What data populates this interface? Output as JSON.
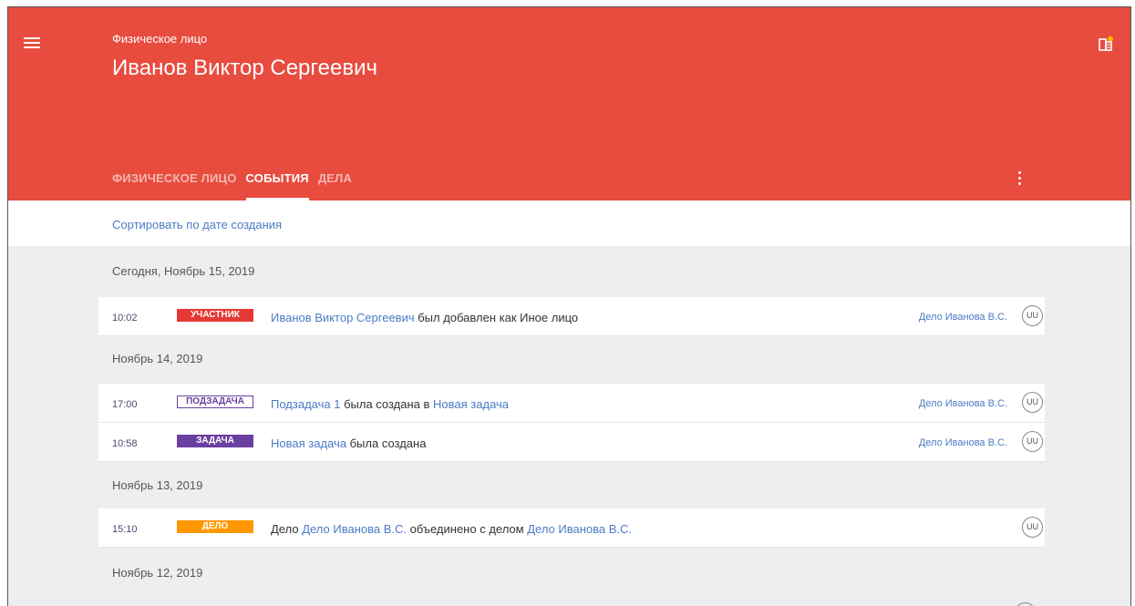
{
  "header": {
    "subtitle": "Физическое лицо",
    "title": "Иванов Виктор Сергеевич",
    "tabs": [
      {
        "label": "ФИЗИЧЕСКОЕ ЛИЦО",
        "active": false
      },
      {
        "label": "СОБЫТИЯ",
        "active": true
      },
      {
        "label": "ДЕЛА",
        "active": false
      }
    ],
    "icons": {
      "menu": "menu-icon",
      "brand": "app-switch-icon",
      "more": "more-vert-icon"
    }
  },
  "sort": {
    "label": "Сортировать по дате создания"
  },
  "colors": {
    "header_bg": "#e74c3f",
    "badge_participant": "#e53935",
    "badge_task": "#6b3fa0",
    "badge_case": "#ff9800",
    "link": "#4a7bc4"
  },
  "days": [
    {
      "label": "Сегодня, Ноябрь 15, 2019"
    },
    {
      "label": "Ноябрь 14, 2019"
    },
    {
      "label": "Ноябрь 13, 2019"
    },
    {
      "label": "Ноябрь 12, 2019"
    }
  ],
  "events": [
    {
      "time": "10:02",
      "badge": "УЧАСТНИК",
      "badge_color": "#e53935",
      "badge_style": "filled",
      "parts": [
        {
          "text": "Иванов Виктор Сергеевич",
          "link": true
        },
        {
          "text": " был добавлен как Иное лицо",
          "link": false
        }
      ],
      "case": "Дело Иванова В.С.",
      "avatar": "UU"
    },
    {
      "time": "17:00",
      "badge": "ПОДЗАДАЧА",
      "badge_color": "#6b3fa0",
      "badge_style": "outline",
      "parts": [
        {
          "text": "Подзадача 1",
          "link": true
        },
        {
          "text": " была создана в ",
          "link": false
        },
        {
          "text": "Новая задача",
          "link": true
        }
      ],
      "case": "Дело Иванова В.С.",
      "avatar": "UU"
    },
    {
      "time": "10:58",
      "badge": "ЗАДАЧА",
      "badge_color": "#6b3fa0",
      "badge_style": "filled",
      "parts": [
        {
          "text": "Новая задача",
          "link": true
        },
        {
          "text": " была создана",
          "link": false
        }
      ],
      "case": "Дело Иванова В.С.",
      "avatar": "UU"
    },
    {
      "time": "15:10",
      "badge": "ДЕЛО",
      "badge_color": "#ff9800",
      "badge_style": "filled",
      "parts": [
        {
          "text": "Дело ",
          "link": false
        },
        {
          "text": "Дело Иванова В.С.",
          "link": true
        },
        {
          "text": " объединено с делом ",
          "link": false
        },
        {
          "text": "Дело Иванова В.С.",
          "link": true
        }
      ],
      "case": "",
      "avatar": "UU"
    }
  ]
}
